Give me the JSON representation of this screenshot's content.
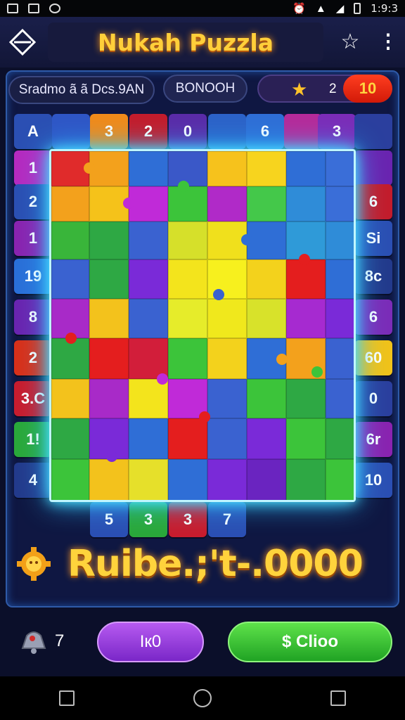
{
  "status": {
    "time": "1:9:3"
  },
  "header": {
    "title": "Nukah Puzzla"
  },
  "top_row": {
    "score_label": "Sradmo ã ã Dcs.9AN",
    "mode_label": "BONOOH",
    "stars": "2",
    "level": "10"
  },
  "grid_labels": {
    "top": [
      "A",
      "3",
      "2",
      "0",
      "",
      "6",
      "",
      "3"
    ],
    "left": [
      "1",
      "2",
      "1",
      "19",
      "8",
      "2",
      "3.C",
      "1!",
      "4"
    ],
    "right": [
      "",
      "6",
      "Si",
      "8c",
      "6",
      "60",
      "0",
      "6r",
      "10"
    ],
    "bottom": [
      "5",
      "3",
      "3",
      "7"
    ]
  },
  "coins_text": "Ruibe.;'t-.0000",
  "bell_count": "7",
  "buttons": {
    "left": "Iк0",
    "right": "$ Clioo"
  },
  "colors": {
    "accent_gold": "#ffcf3a",
    "badge_red": "#e5260f",
    "btn_purple": "#9b3fe0",
    "btn_green": "#3cc53a"
  }
}
